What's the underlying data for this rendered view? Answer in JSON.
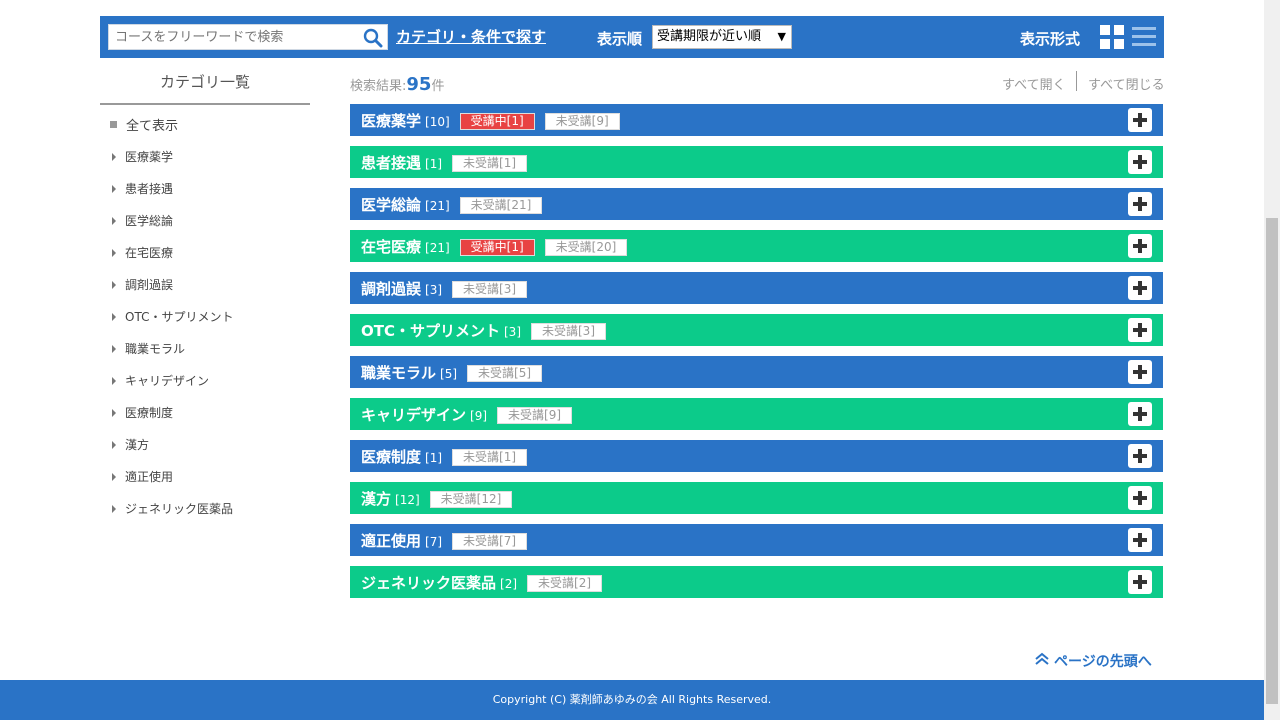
{
  "header": {
    "search_placeholder": "コースをフリーワードで検索",
    "category_link": "カテゴリ・条件で探す",
    "sort_label": "表示順",
    "sort_selected": "受講期限が近い順",
    "view_label": "表示形式"
  },
  "sidebar": {
    "title": "カテゴリ一覧",
    "all_label": "全て表示",
    "items": [
      {
        "label": "医療薬学"
      },
      {
        "label": "患者接遇"
      },
      {
        "label": "医学総論"
      },
      {
        "label": "在宅医療"
      },
      {
        "label": "調剤過誤"
      },
      {
        "label": "OTC・サプリメント"
      },
      {
        "label": "職業モラル"
      },
      {
        "label": "キャリデザイン"
      },
      {
        "label": "医療制度"
      },
      {
        "label": "漢方"
      },
      {
        "label": "適正使用"
      },
      {
        "label": "ジェネリック医薬品"
      }
    ]
  },
  "results": {
    "label": "検索結果:",
    "count": "95",
    "unit": "件",
    "expand_all": "すべて開く",
    "collapse_all": "すべて閉じる"
  },
  "categories": [
    {
      "name": "医療薬学",
      "count": "[10]",
      "color": "blue",
      "active": "受講中[1]",
      "pending": "未受講[9]"
    },
    {
      "name": "患者接遇",
      "count": "[1]",
      "color": "green",
      "active": null,
      "pending": "未受講[1]"
    },
    {
      "name": "医学総論",
      "count": "[21]",
      "color": "blue",
      "active": null,
      "pending": "未受講[21]"
    },
    {
      "name": "在宅医療",
      "count": "[21]",
      "color": "green",
      "active": "受講中[1]",
      "pending": "未受講[20]"
    },
    {
      "name": "調剤過誤",
      "count": "[3]",
      "color": "blue",
      "active": null,
      "pending": "未受講[3]"
    },
    {
      "name": "OTC・サプリメント",
      "count": "[3]",
      "color": "green",
      "active": null,
      "pending": "未受講[3]"
    },
    {
      "name": "職業モラル",
      "count": "[5]",
      "color": "blue",
      "active": null,
      "pending": "未受講[5]"
    },
    {
      "name": "キャリデザイン",
      "count": "[9]",
      "color": "green",
      "active": null,
      "pending": "未受講[9]"
    },
    {
      "name": "医療制度",
      "count": "[1]",
      "color": "blue",
      "active": null,
      "pending": "未受講[1]"
    },
    {
      "name": "漢方",
      "count": "[12]",
      "color": "green",
      "active": null,
      "pending": "未受講[12]"
    },
    {
      "name": "適正使用",
      "count": "[7]",
      "color": "blue",
      "active": null,
      "pending": "未受講[7]"
    },
    {
      "name": "ジェネリック医薬品",
      "count": "[2]",
      "color": "green",
      "active": null,
      "pending": "未受講[2]"
    }
  ],
  "back_to_top": "ページの先頭へ",
  "footer": {
    "copyright": "Copyright (C) 薬剤師あゆみの会 All Rights Reserved."
  },
  "colors": {
    "primary_blue": "#2a73c6",
    "green": "#0ccb8a",
    "active_red": "#e84343"
  }
}
